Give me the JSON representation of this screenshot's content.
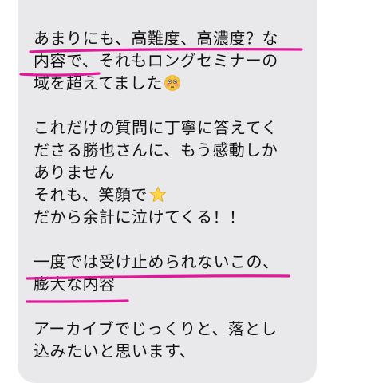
{
  "message": {
    "paragraph1": [
      "あまりにも、高難度、高濃度？な",
      "内容で、それもロングセミナーの",
      "域を超えてました"
    ],
    "paragraph2": [
      "これだけの質問に丁寧に答えてく",
      "ださる勝也さんに、もう感動しか",
      "ありません",
      "それも、笑顔で",
      "だから余計に泣けてくる！！"
    ],
    "paragraph3": [
      "一度では受け止められないこの、",
      "膨大な内容"
    ],
    "paragraph4": [
      "アーカイブでじっくりと、落とし",
      "込みたいと思います、"
    ]
  },
  "icons": {
    "flushed_emoji": "flushed-face-icon",
    "star_emoji": "star-icon"
  },
  "colors": {
    "bubble": "#e9e9eb",
    "text": "#111111",
    "underline": "#e0199a"
  }
}
